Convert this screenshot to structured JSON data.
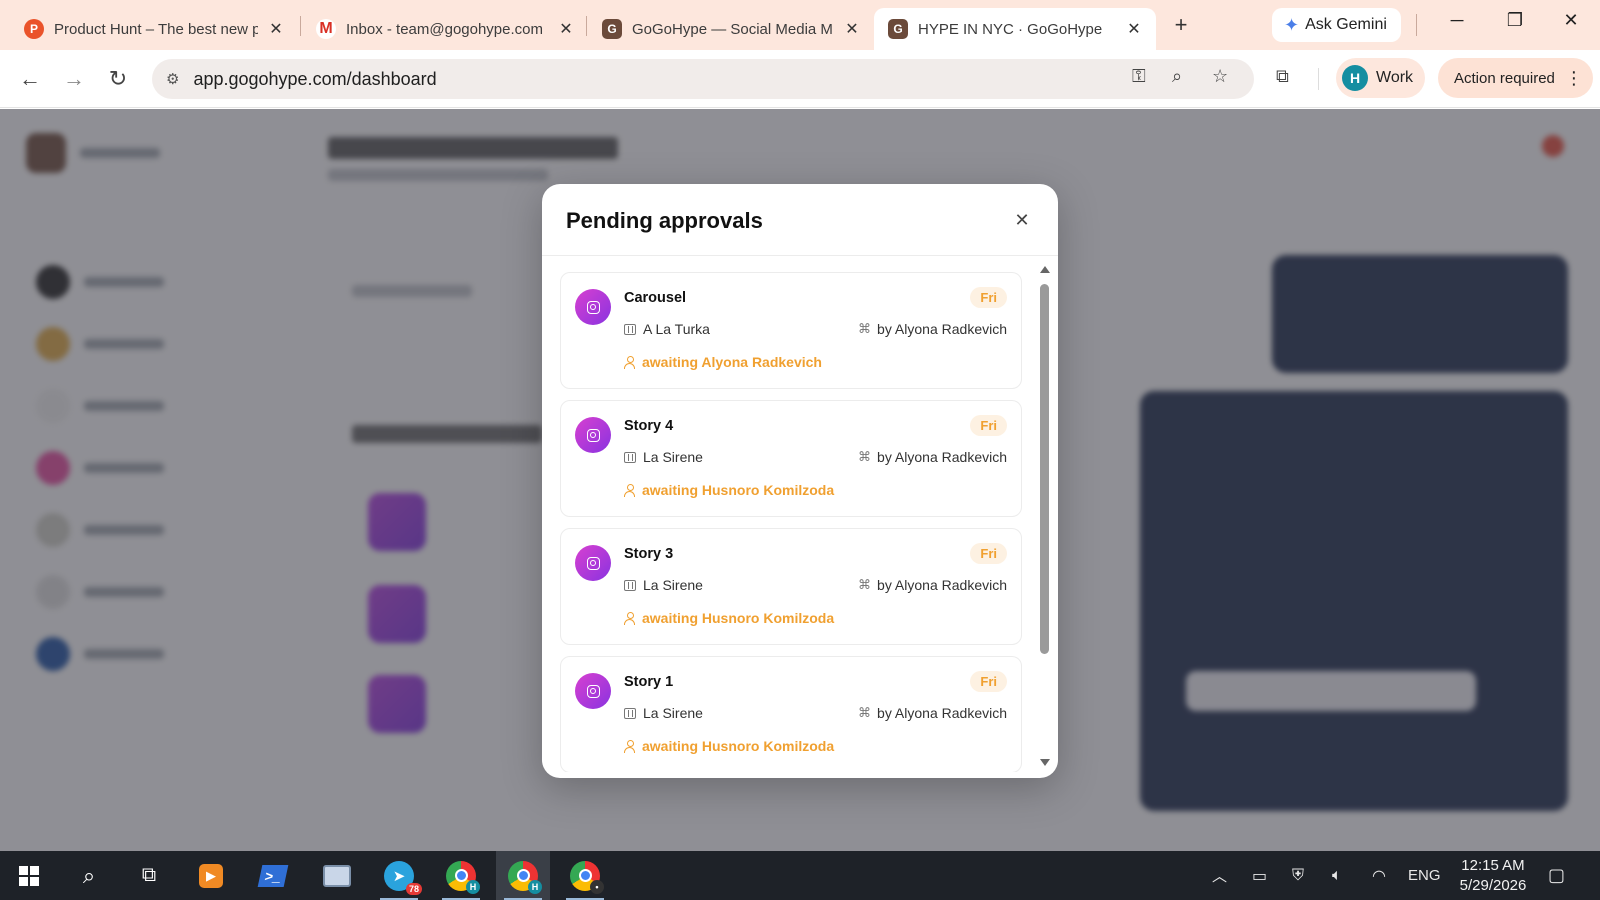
{
  "browser": {
    "tabs": [
      {
        "title": "Product Hunt – The best new p",
        "favicon": "product-hunt-icon",
        "favicon_letter": "P",
        "color": "#ea532a"
      },
      {
        "title": "Inbox - team@gogohype.com",
        "favicon": "gmail-icon",
        "favicon_letter": "M",
        "color": "#d93025"
      },
      {
        "title": "GoGoHype — Social Media M",
        "favicon": "gogohype-icon",
        "favicon_letter": "G",
        "color": "#6b4a3a"
      },
      {
        "title": "HYPE IN NYC · GoGoHype",
        "favicon": "gogohype-icon",
        "favicon_letter": "G",
        "color": "#6b4a3a",
        "active": true
      }
    ],
    "ask_gemini": "Ask Gemini",
    "url": "app.gogohype.com/dashboard",
    "profile": {
      "initial": "H",
      "label": "Work"
    },
    "action_required": "Action required"
  },
  "modal": {
    "title": "Pending approvals",
    "accent": "#f0a030",
    "items": [
      {
        "title": "Carousel",
        "day": "Fri",
        "client": "A La Turka",
        "by": "by Alyona Radkevich",
        "awaiting": "awaiting Alyona Radkevich"
      },
      {
        "title": "Story 4",
        "day": "Fri",
        "client": "La Sirene",
        "by": "by Alyona Radkevich",
        "awaiting": "awaiting Husnoro Komilzoda"
      },
      {
        "title": "Story 3",
        "day": "Fri",
        "client": "La Sirene",
        "by": "by Alyona Radkevich",
        "awaiting": "awaiting Husnoro Komilzoda"
      },
      {
        "title": "Story 1",
        "day": "Fri",
        "client": "La Sirene",
        "by": "by Alyona Radkevich",
        "awaiting": "awaiting Husnoro Komilzoda"
      }
    ]
  },
  "taskbar": {
    "telegram_badge": "78",
    "language": "ENG",
    "time": "12:15 AM",
    "date": "5/29/2026"
  }
}
